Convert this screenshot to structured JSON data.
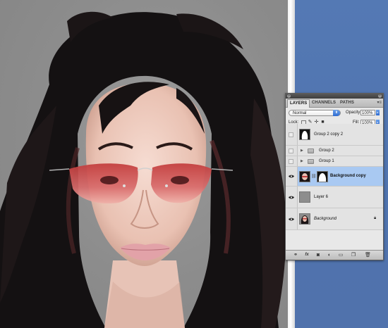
{
  "panel": {
    "tabs": [
      {
        "label": "LAYERS",
        "active": true
      },
      {
        "label": "CHANNELS",
        "active": false
      },
      {
        "label": "PATHS",
        "active": false
      }
    ],
    "menu_icon": "panel-menu-icon",
    "blend_mode": "Normal",
    "opacity_label": "Opacity:",
    "opacity_value": "100%",
    "lock_label": "Lock:",
    "fill_label": "Fill:",
    "fill_value": "100%"
  },
  "layers": [
    {
      "name": "Group 2 copy 2",
      "visible": false,
      "type": "layer-with-thumb",
      "thumb": "white-mask"
    },
    {
      "name": "Group 2",
      "visible": false,
      "type": "group"
    },
    {
      "name": "Group 1",
      "visible": false,
      "type": "group"
    },
    {
      "name": "Background copy",
      "visible": true,
      "type": "layer-with-mask",
      "selected": true
    },
    {
      "name": "Layer 6",
      "visible": true,
      "type": "layer-with-thumb",
      "thumb": "gray"
    },
    {
      "name": "Background",
      "visible": true,
      "type": "background",
      "locked": true
    }
  ],
  "footer_icons": [
    "link-layers-icon",
    "fx-icon",
    "add-mask-icon",
    "adjustment-layer-icon",
    "new-group-icon",
    "new-layer-icon",
    "trash-icon"
  ],
  "colors": {
    "desktop": "#5077b2",
    "selected_row": "#a9c9f2",
    "canvas_bg": "#8c8c8c"
  }
}
